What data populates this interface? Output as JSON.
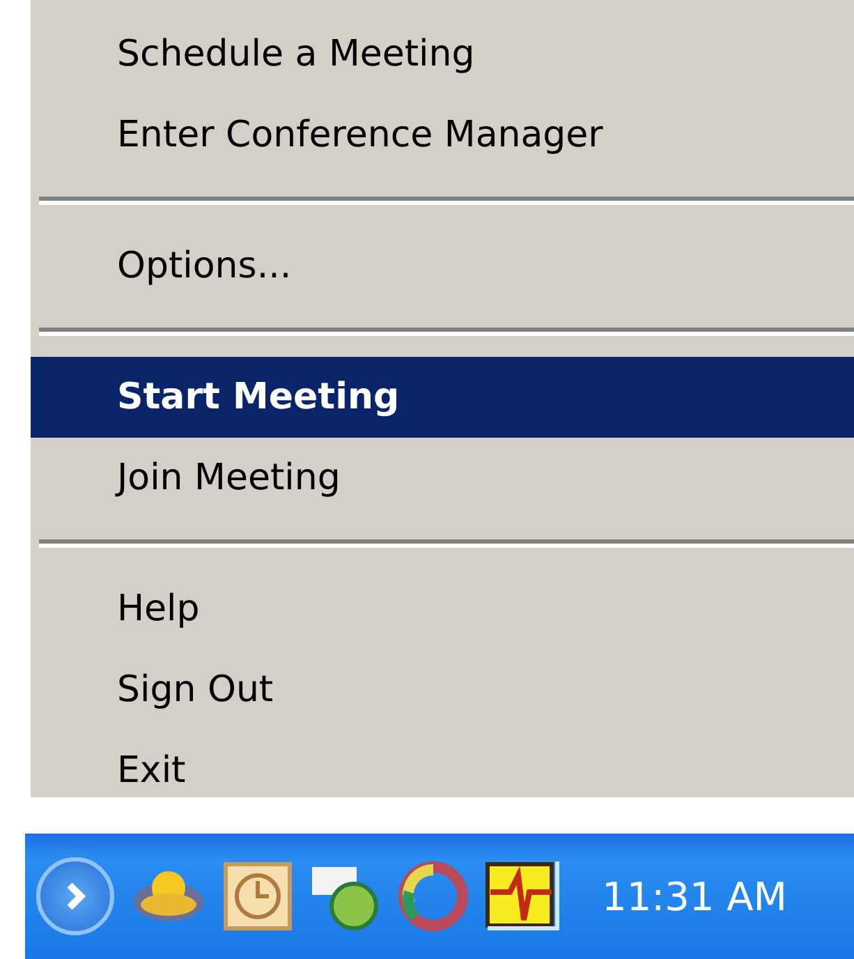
{
  "menu": {
    "items": [
      {
        "kind": "item",
        "label": "Schedule a Meeting",
        "selected": false,
        "default": false
      },
      {
        "kind": "item",
        "label": "Enter Conference Manager",
        "selected": false,
        "default": false
      },
      {
        "kind": "separator"
      },
      {
        "kind": "item",
        "label": "Options...",
        "selected": false,
        "default": false
      },
      {
        "kind": "separator"
      },
      {
        "kind": "item",
        "label": "Start Meeting",
        "selected": true,
        "default": true
      },
      {
        "kind": "item",
        "label": "Join Meeting",
        "selected": false,
        "default": false
      },
      {
        "kind": "separator"
      },
      {
        "kind": "item",
        "label": "Help",
        "selected": false,
        "default": false
      },
      {
        "kind": "item",
        "label": "Sign Out",
        "selected": false,
        "default": false
      },
      {
        "kind": "item",
        "label": "Exit",
        "selected": false,
        "default": false
      }
    ]
  },
  "taskbar": {
    "clock": "11:31 AM"
  }
}
